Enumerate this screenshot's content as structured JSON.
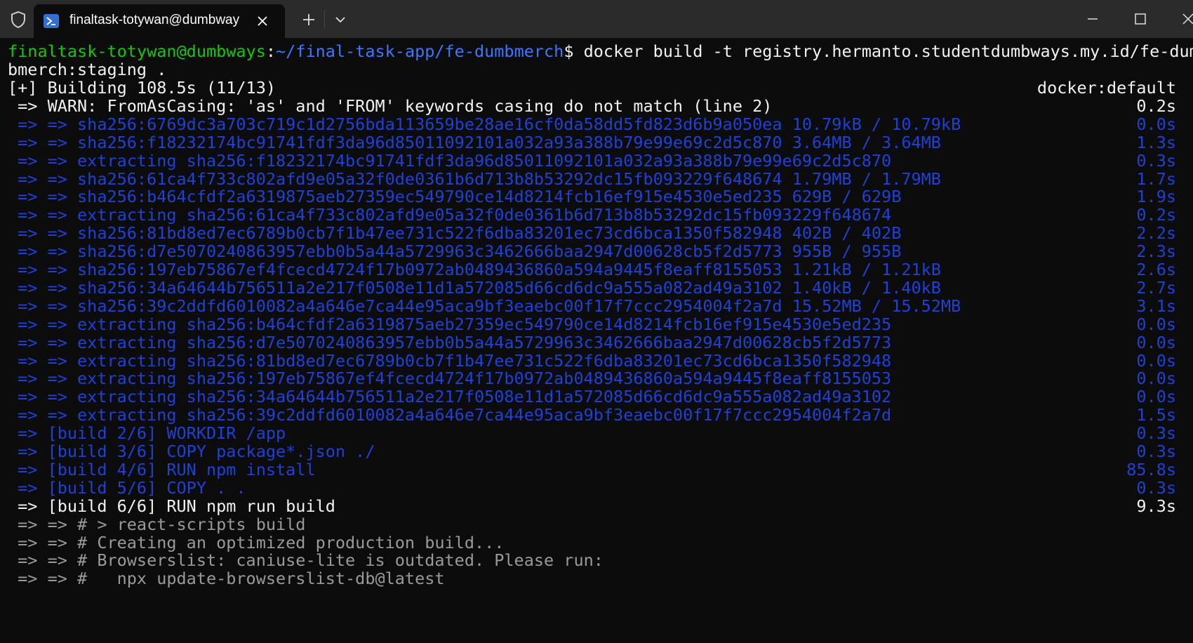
{
  "window": {
    "tab_title": "finaltask-totywan@dumbway",
    "icons": {
      "shield": "shield-icon",
      "terminal": "powershell-icon",
      "close_tab": "close-icon",
      "new_tab": "plus-icon",
      "dropdown": "chevron-down-icon",
      "minimize": "minimize-icon",
      "maximize": "maximize-icon",
      "close_window": "close-icon"
    }
  },
  "colors": {
    "background": "#0c0c0c",
    "titlebar": "#2b2b2b",
    "prompt_user": "#16c60c",
    "prompt_path": "#3b78ff",
    "step_blue": "#1f41d6",
    "text": "#f2f2f2",
    "log_gray": "#9a9a9a"
  },
  "terminal": {
    "prompt_user": "finaltask-totywan@dumbways",
    "prompt_sep": ":",
    "prompt_path": "~/final-task-app/fe-dumbmerch",
    "prompt_symbol": "$ ",
    "command": "docker build -t registry.hermanto.studentdumbways.my.id/fe-dum",
    "command_cont": "bmerch:staging .",
    "lines": [
      {
        "text": "[+] Building 108.5s (11/13)",
        "right": "docker:default",
        "color": "white"
      },
      {
        "text": " => WARN: FromAsCasing: 'as' and 'FROM' keywords casing do not match (line 2)",
        "right": "0.2s",
        "color": "white"
      },
      {
        "text": " => => sha256:6769dc3a703c719c1d2756bda113659be28ae16cf0da58dd5fd823d6b9a050ea 10.79kB / 10.79kB",
        "right": "0.0s",
        "color": "blue"
      },
      {
        "text": " => => sha256:f18232174bc91741fdf3da96d85011092101a032a93a388b79e99e69c2d5c870 3.64MB / 3.64MB",
        "right": "1.3s",
        "color": "blue"
      },
      {
        "text": " => => extracting sha256:f18232174bc91741fdf3da96d85011092101a032a93a388b79e99e69c2d5c870",
        "right": "0.3s",
        "color": "blue"
      },
      {
        "text": " => => sha256:61ca4f733c802afd9e05a32f0de0361b6d713b8b53292dc15fb093229f648674 1.79MB / 1.79MB",
        "right": "1.7s",
        "color": "blue"
      },
      {
        "text": " => => sha256:b464cfdf2a6319875aeb27359ec549790ce14d8214fcb16ef915e4530e5ed235 629B / 629B",
        "right": "1.9s",
        "color": "blue"
      },
      {
        "text": " => => extracting sha256:61ca4f733c802afd9e05a32f0de0361b6d713b8b53292dc15fb093229f648674",
        "right": "0.2s",
        "color": "blue"
      },
      {
        "text": " => => sha256:81bd8ed7ec6789b0cb7f1b47ee731c522f6dba83201ec73cd6bca1350f582948 402B / 402B",
        "right": "2.2s",
        "color": "blue"
      },
      {
        "text": " => => sha256:d7e5070240863957ebb0b5a44a5729963c3462666baa2947d00628cb5f2d5773 955B / 955B",
        "right": "2.3s",
        "color": "blue"
      },
      {
        "text": " => => sha256:197eb75867ef4fcecd4724f17b0972ab0489436860a594a9445f8eaff8155053 1.21kB / 1.21kB",
        "right": "2.6s",
        "color": "blue"
      },
      {
        "text": " => => sha256:34a64644b756511a2e217f0508e11d1a572085d66cd6dc9a555a082ad49a3102 1.40kB / 1.40kB",
        "right": "2.7s",
        "color": "blue"
      },
      {
        "text": " => => sha256:39c2ddfd6010082a4a646e7ca44e95aca9bf3eaebc00f17f7ccc2954004f2a7d 15.52MB / 15.52MB",
        "right": "3.1s",
        "color": "blue"
      },
      {
        "text": " => => extracting sha256:b464cfdf2a6319875aeb27359ec549790ce14d8214fcb16ef915e4530e5ed235",
        "right": "0.0s",
        "color": "blue"
      },
      {
        "text": " => => extracting sha256:d7e5070240863957ebb0b5a44a5729963c3462666baa2947d00628cb5f2d5773",
        "right": "0.0s",
        "color": "blue"
      },
      {
        "text": " => => extracting sha256:81bd8ed7ec6789b0cb7f1b47ee731c522f6dba83201ec73cd6bca1350f582948",
        "right": "0.0s",
        "color": "blue"
      },
      {
        "text": " => => extracting sha256:197eb75867ef4fcecd4724f17b0972ab0489436860a594a9445f8eaff8155053",
        "right": "0.0s",
        "color": "blue"
      },
      {
        "text": " => => extracting sha256:34a64644b756511a2e217f0508e11d1a572085d66cd6dc9a555a082ad49a3102",
        "right": "0.0s",
        "color": "blue"
      },
      {
        "text": " => => extracting sha256:39c2ddfd6010082a4a646e7ca44e95aca9bf3eaebc00f17f7ccc2954004f2a7d",
        "right": "1.5s",
        "color": "blue"
      },
      {
        "text": " => [build 2/6] WORKDIR /app",
        "right": "0.3s",
        "color": "blue"
      },
      {
        "text": " => [build 3/6] COPY package*.json ./",
        "right": "0.3s",
        "color": "blue"
      },
      {
        "text": " => [build 4/6] RUN npm install",
        "right": "85.8s",
        "color": "blue"
      },
      {
        "text": " => [build 5/6] COPY . .",
        "right": "0.3s",
        "color": "blue"
      },
      {
        "text": " => [build 6/6] RUN npm run build",
        "right": "9.3s",
        "color": "white"
      },
      {
        "text": " => => # > react-scripts build",
        "right": "",
        "color": "gray"
      },
      {
        "text": " => => # Creating an optimized production build...",
        "right": "",
        "color": "gray"
      },
      {
        "text": " => => # Browserslist: caniuse-lite is outdated. Please run:",
        "right": "",
        "color": "gray"
      },
      {
        "text": " => => #   npx update-browserslist-db@latest",
        "right": "",
        "color": "gray"
      }
    ]
  }
}
